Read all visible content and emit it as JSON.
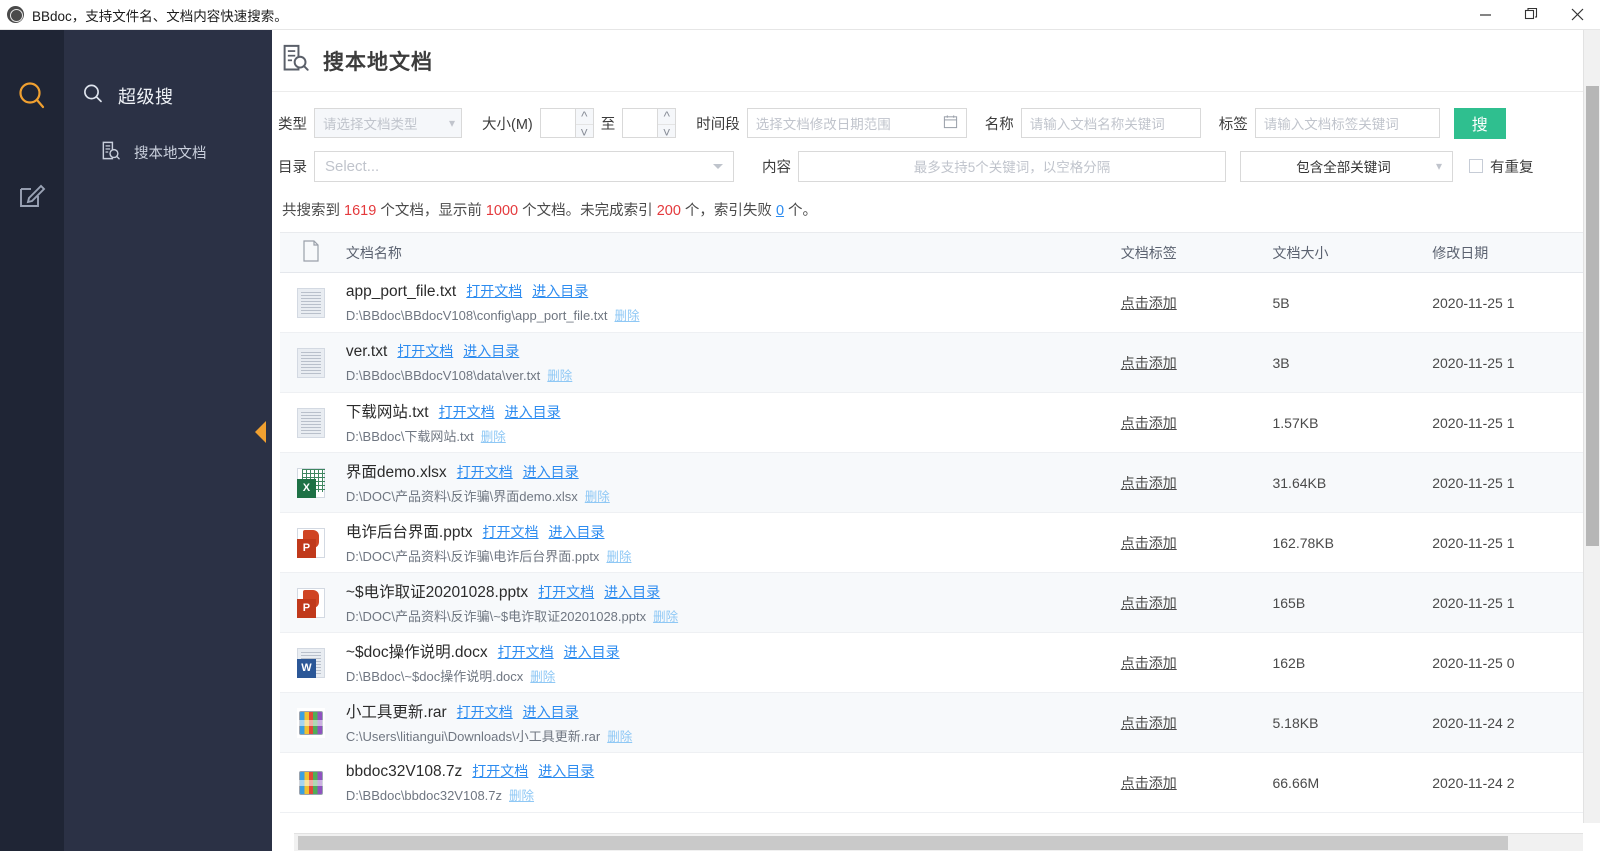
{
  "window": {
    "title": "BBdoc，支持文件名、文档内容快速搜索。",
    "minimize_label": "minimize",
    "maximize_label": "restore",
    "close_label": "close"
  },
  "rail": {
    "items": [
      {
        "icon": "search-icon",
        "active": true,
        "color": "#f0a030"
      },
      {
        "icon": "edit-icon",
        "active": false,
        "color": "#9aa3b5"
      }
    ]
  },
  "sidebar": {
    "group_label": "超级搜",
    "items": [
      {
        "label": "搜本地文档",
        "icon": "doc-search-icon"
      }
    ]
  },
  "page": {
    "title": "搜本地文档",
    "icon": "doc-search-icon"
  },
  "filters": {
    "type_label": "类型",
    "type_placeholder": "请选择文档类型",
    "size_label": "大小(M)",
    "size_from_value": "",
    "size_to_value": "",
    "size_between": "至",
    "time_label": "时间段",
    "time_placeholder": "选择文档修改日期范围",
    "name_label": "名称",
    "name_placeholder": "请输入文档名称关键词",
    "tag_label": "标签",
    "tag_placeholder": "请输入文档标签关键词",
    "search_button": "搜",
    "dir_label": "目录",
    "dir_placeholder": "Select...",
    "content_label": "内容",
    "content_placeholder": "最多支持5个关键词，以空格分隔",
    "logic_value": "包含全部关键词",
    "duplicate_label": "有重复",
    "duplicate_checked": false
  },
  "summary": {
    "prefix": "共搜索到 ",
    "total": "1619",
    "mid1": " 个文档，显示前 ",
    "shown": "1000",
    "mid2": " 个文档。未完成索引 ",
    "pending": "200",
    "mid3": " 个，索引失败 ",
    "failed": "0",
    "suffix": " 个。"
  },
  "table": {
    "columns": {
      "icon": "",
      "name": "文档名称",
      "tag": "文档标签",
      "size": "文档大小",
      "date": "修改日期"
    },
    "row_actions": {
      "open": "打开文档",
      "goto": "进入目录",
      "delete": "删除",
      "add_tag": "点击添加"
    },
    "rows": [
      {
        "icon": "txt",
        "name": "app_port_file.txt",
        "path": "D:\\BBdoc\\BBdocV108\\config\\app_port_file.txt",
        "tag": "点击添加",
        "size": "5B",
        "date": "2020-11-25 1"
      },
      {
        "icon": "txt",
        "name": "ver.txt",
        "path": "D:\\BBdoc\\BBdocV108\\data\\ver.txt",
        "tag": "点击添加",
        "size": "3B",
        "date": "2020-11-25 1"
      },
      {
        "icon": "txt",
        "name": "下载网站.txt",
        "path": "D:\\BBdoc\\下载网站.txt",
        "tag": "点击添加",
        "size": "1.57KB",
        "date": "2020-11-25 1"
      },
      {
        "icon": "xlsx",
        "name": "界面demo.xlsx",
        "path": "D:\\DOC\\产品资料\\反诈骗\\界面demo.xlsx",
        "tag": "点击添加",
        "size": "31.64KB",
        "date": "2020-11-25 1"
      },
      {
        "icon": "pptx",
        "name": "电诈后台界面.pptx",
        "path": "D:\\DOC\\产品资料\\反诈骗\\电诈后台界面.pptx",
        "tag": "点击添加",
        "size": "162.78KB",
        "date": "2020-11-25 1"
      },
      {
        "icon": "pptx",
        "name": "~$电诈取证20201028.pptx",
        "path": "D:\\DOC\\产品资料\\反诈骗\\~$电诈取证20201028.pptx",
        "tag": "点击添加",
        "size": "165B",
        "date": "2020-11-25 1"
      },
      {
        "icon": "docx",
        "name": "~$doc操作说明.docx",
        "path": "D:\\BBdoc\\~$doc操作说明.docx",
        "tag": "点击添加",
        "size": "162B",
        "date": "2020-11-25 0"
      },
      {
        "icon": "rar",
        "name": "小工具更新.rar",
        "path": "C:\\Users\\litiangui\\Downloads\\小工具更新.rar",
        "tag": "点击添加",
        "size": "5.18KB",
        "date": "2020-11-24 2"
      },
      {
        "icon": "z7",
        "name": "bbdoc32V108.7z",
        "path": "D:\\BBdoc\\bbdoc32V108.7z",
        "tag": "点击添加",
        "size": "66.66M",
        "date": "2020-11-24 2"
      }
    ]
  },
  "colors": {
    "accent_orange": "#f0a030",
    "link_blue": "#2d8cf0",
    "search_green": "#2fbf8f",
    "sidebar_dark": "#2b3145",
    "rail_dark": "#1f2535",
    "red_number": "#e4393c"
  }
}
